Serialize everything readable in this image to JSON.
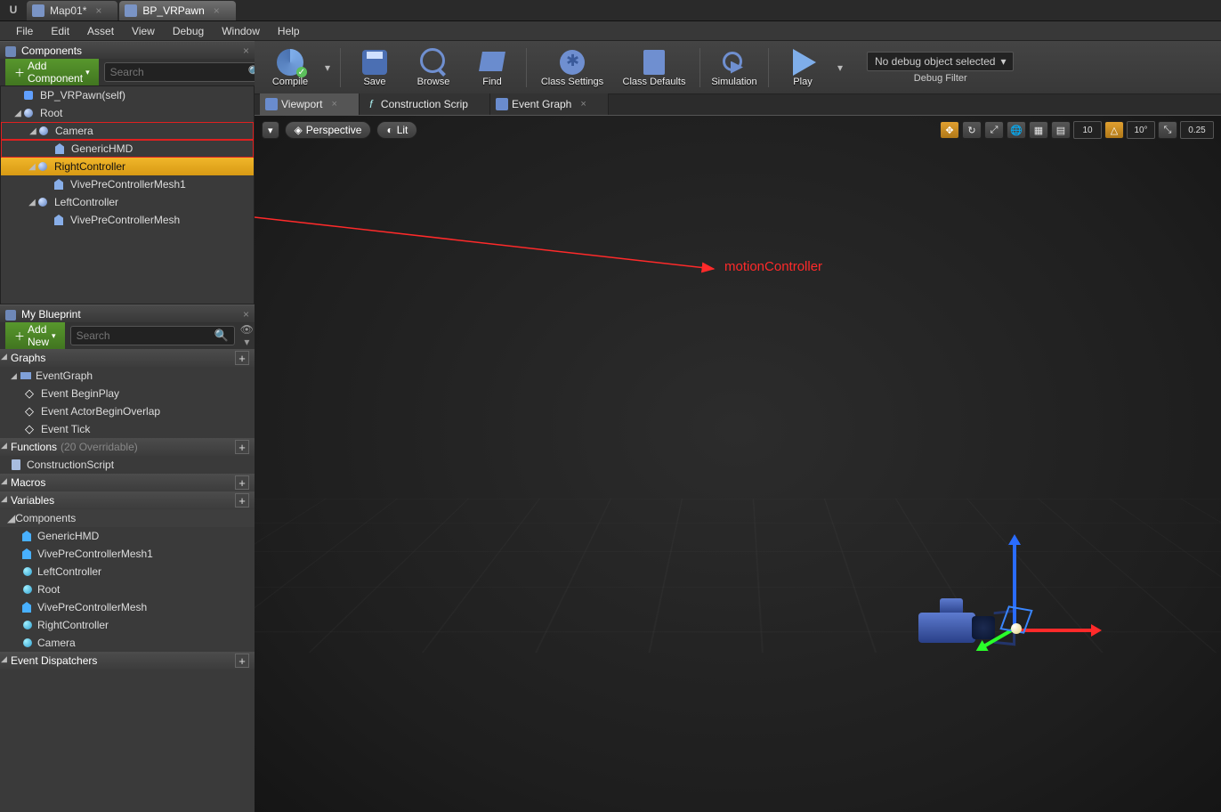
{
  "titleTabs": [
    {
      "label": "Map01*",
      "active": false
    },
    {
      "label": "BP_VRPawn",
      "active": true
    }
  ],
  "menu": [
    "File",
    "Edit",
    "Asset",
    "View",
    "Debug",
    "Window",
    "Help"
  ],
  "componentsPanel": {
    "title": "Components",
    "addBtn": "Add Component",
    "searchPlaceholder": "Search",
    "tree": [
      {
        "label": "BP_VRPawn(self)",
        "indent": 0,
        "icon": "self"
      },
      {
        "label": "Root",
        "indent": 0,
        "icon": "scene",
        "arrow": true
      },
      {
        "label": "Camera",
        "indent": 1,
        "icon": "scene",
        "arrow": true,
        "red": true
      },
      {
        "label": "GenericHMD",
        "indent": 2,
        "icon": "mesh",
        "red": true
      },
      {
        "label": "RightController",
        "indent": 1,
        "icon": "scene",
        "arrow": true,
        "selected": true
      },
      {
        "label": "VivePreControllerMesh1",
        "indent": 2,
        "icon": "mesh"
      },
      {
        "label": "LeftController",
        "indent": 1,
        "icon": "scene",
        "arrow": true
      },
      {
        "label": "VivePreControllerMesh",
        "indent": 2,
        "icon": "mesh"
      }
    ]
  },
  "myBlueprint": {
    "title": "My Blueprint",
    "addBtn": "Add New",
    "searchPlaceholder": "Search",
    "sections": {
      "graphs": {
        "title": "Graphs",
        "items": [
          {
            "label": "EventGraph",
            "icon": "graph",
            "arrow": true
          },
          {
            "label": "Event BeginPlay",
            "icon": "evt"
          },
          {
            "label": "Event ActorBeginOverlap",
            "icon": "evt"
          },
          {
            "label": "Event Tick",
            "icon": "evt"
          }
        ]
      },
      "functions": {
        "title": "Functions",
        "hint": "(20 Overridable)",
        "items": [
          {
            "label": "ConstructionScript",
            "icon": "func"
          }
        ]
      },
      "macros": {
        "title": "Macros"
      },
      "variables": {
        "title": "Variables",
        "subheader": "Components",
        "items": [
          {
            "label": "GenericHMD",
            "icon": "var-mesh"
          },
          {
            "label": "VivePreControllerMesh1",
            "icon": "var-mesh"
          },
          {
            "label": "LeftController",
            "icon": "var-sc"
          },
          {
            "label": "Root",
            "icon": "var-sc"
          },
          {
            "label": "VivePreControllerMesh",
            "icon": "var-mesh"
          },
          {
            "label": "RightController",
            "icon": "var-sc"
          },
          {
            "label": "Camera",
            "icon": "var-sc"
          }
        ]
      },
      "dispatchers": {
        "title": "Event Dispatchers"
      }
    }
  },
  "toolbar": {
    "compile": "Compile",
    "save": "Save",
    "browse": "Browse",
    "find": "Find",
    "classSettings": "Class Settings",
    "classDefaults": "Class Defaults",
    "simulation": "Simulation",
    "play": "Play",
    "debugSelected": "No debug object selected",
    "debugFilter": "Debug Filter"
  },
  "editorTabs": [
    {
      "label": "Viewport",
      "closable": true,
      "active": true
    },
    {
      "label": "Construction Scrip",
      "closable": false,
      "icon": "f"
    },
    {
      "label": "Event Graph",
      "closable": true
    }
  ],
  "viewport": {
    "mode": "Perspective",
    "lit": "Lit",
    "snapPos": "10",
    "snapRot": "10°",
    "snapScale": "0.25"
  },
  "annotation": {
    "text": "motionController"
  }
}
